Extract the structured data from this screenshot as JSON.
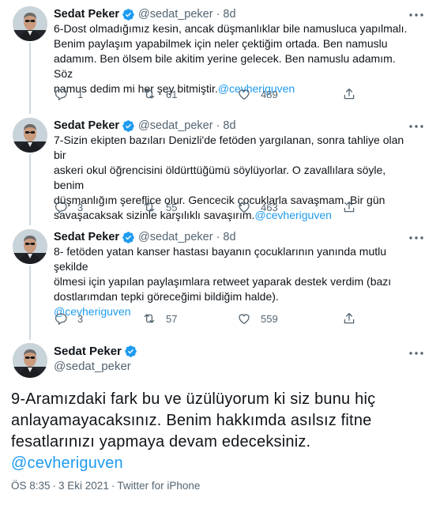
{
  "author": {
    "name": "Sedat Peker",
    "handle": "@sedat_peker"
  },
  "tweets": [
    {
      "time": "8d",
      "text_lines": [
        "6-Dost olmadığımız kesin, ancak düşmanlıklar bile namusluca yapılmalı.",
        "Benim paylaşım yapabilmek için neler çektiğim ortada. Ben namuslu",
        "adamım. Ben ölsem bile akitim yerine gelecek. Ben namuslu adamım. Söz",
        "namus dedim mi her şey bitmiştir."
      ],
      "mention": "@cevheriguven",
      "replies": "1",
      "retweets": "61",
      "likes": "489"
    },
    {
      "time": "8d",
      "text_lines": [
        "7-Sizin ekipten bazıları Denizli'de fetöden yargılanan, sonra tahliye olan bir",
        "askeri okul öğrencisini öldürttüğümü söylüyorlar. O zavallılara söyle, benim",
        "düşmanlığım şereflice olur. Gencecik çocuklarla savaşmam. Bir gün",
        "savaşacaksak sizinle karşılıklı savaşırım."
      ],
      "mention": "@cevheriguven",
      "replies": "3",
      "retweets": "55",
      "likes": "463"
    },
    {
      "time": "8d",
      "text_lines": [
        "8- fetöden yatan kanser hastası bayanın çocuklarının yanında mutlu şekilde",
        "ölmesi için yapılan paylaşımlara retweet yaparak destek verdim (bazı",
        "dostlarımdan tepki göreceğimi bildiğim halde)."
      ],
      "mention": "@cevheriguven",
      "replies": "3",
      "retweets": "57",
      "likes": "559"
    }
  ],
  "main_tweet": {
    "text_lines": [
      "9-Aramızdaki fark bu ve üzülüyorum ki siz bunu hiç",
      "anlayamayacaksınız. Benim hakkımda asılsız fitne",
      "fesatlarınızı yapmaya devam edeceksiniz."
    ],
    "mention": "@cevheriguven",
    "time": "ÖS 8:35",
    "date": "3 Eki 2021",
    "source": "Twitter for iPhone",
    "separator": "·"
  },
  "colors": {
    "accent": "#1d9bf0",
    "secondary_text": "#536471",
    "thread_line": "#cfd9de"
  },
  "icons": [
    "avatar",
    "verified-badge-icon",
    "more-icon",
    "reply-icon",
    "retweet-icon",
    "like-icon",
    "share-icon"
  ]
}
